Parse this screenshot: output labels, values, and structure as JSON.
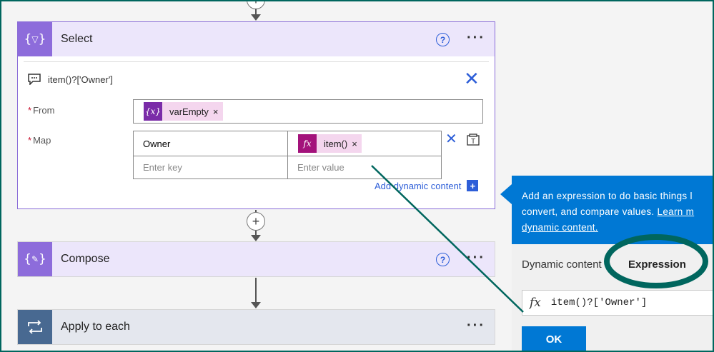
{
  "select_card": {
    "title": "Select",
    "help_glyph": "?",
    "more_glyph": "···",
    "comment": "item()?['Owner']",
    "from_label": "From",
    "from_token": "varEmpty",
    "map_label": "Map",
    "required_marker": "*",
    "map_rows": [
      {
        "key": "Owner",
        "value_token": "item()"
      }
    ],
    "key_placeholder": "Enter key",
    "value_placeholder": "Enter value",
    "add_dynamic_content": "Add dynamic content",
    "add_dynamic_glyph": "+",
    "token_remove": "×"
  },
  "compose_card": {
    "title": "Compose",
    "help_glyph": "?",
    "more_glyph": "···"
  },
  "apply_card": {
    "title": "Apply to each",
    "more_glyph": "···"
  },
  "add_step_glyph": "+",
  "panel": {
    "banner_line1": "Add an expression to do basic things l",
    "banner_line2_text": "convert, and compare values. ",
    "banner_line2_link": "Learn m",
    "banner_line3_link": "dynamic content.",
    "tab_dynamic": "Dynamic content",
    "tab_expression": "Expression",
    "fx_glyph": "fx",
    "expression_value": "item()?['Owner']",
    "ok_label": "OK"
  },
  "colors": {
    "select_accent": "#8d6cdb",
    "apply_accent": "#486991",
    "panel_blue": "#0078d4",
    "annotation": "#00665e",
    "token_pink": "#f4d6ee"
  }
}
